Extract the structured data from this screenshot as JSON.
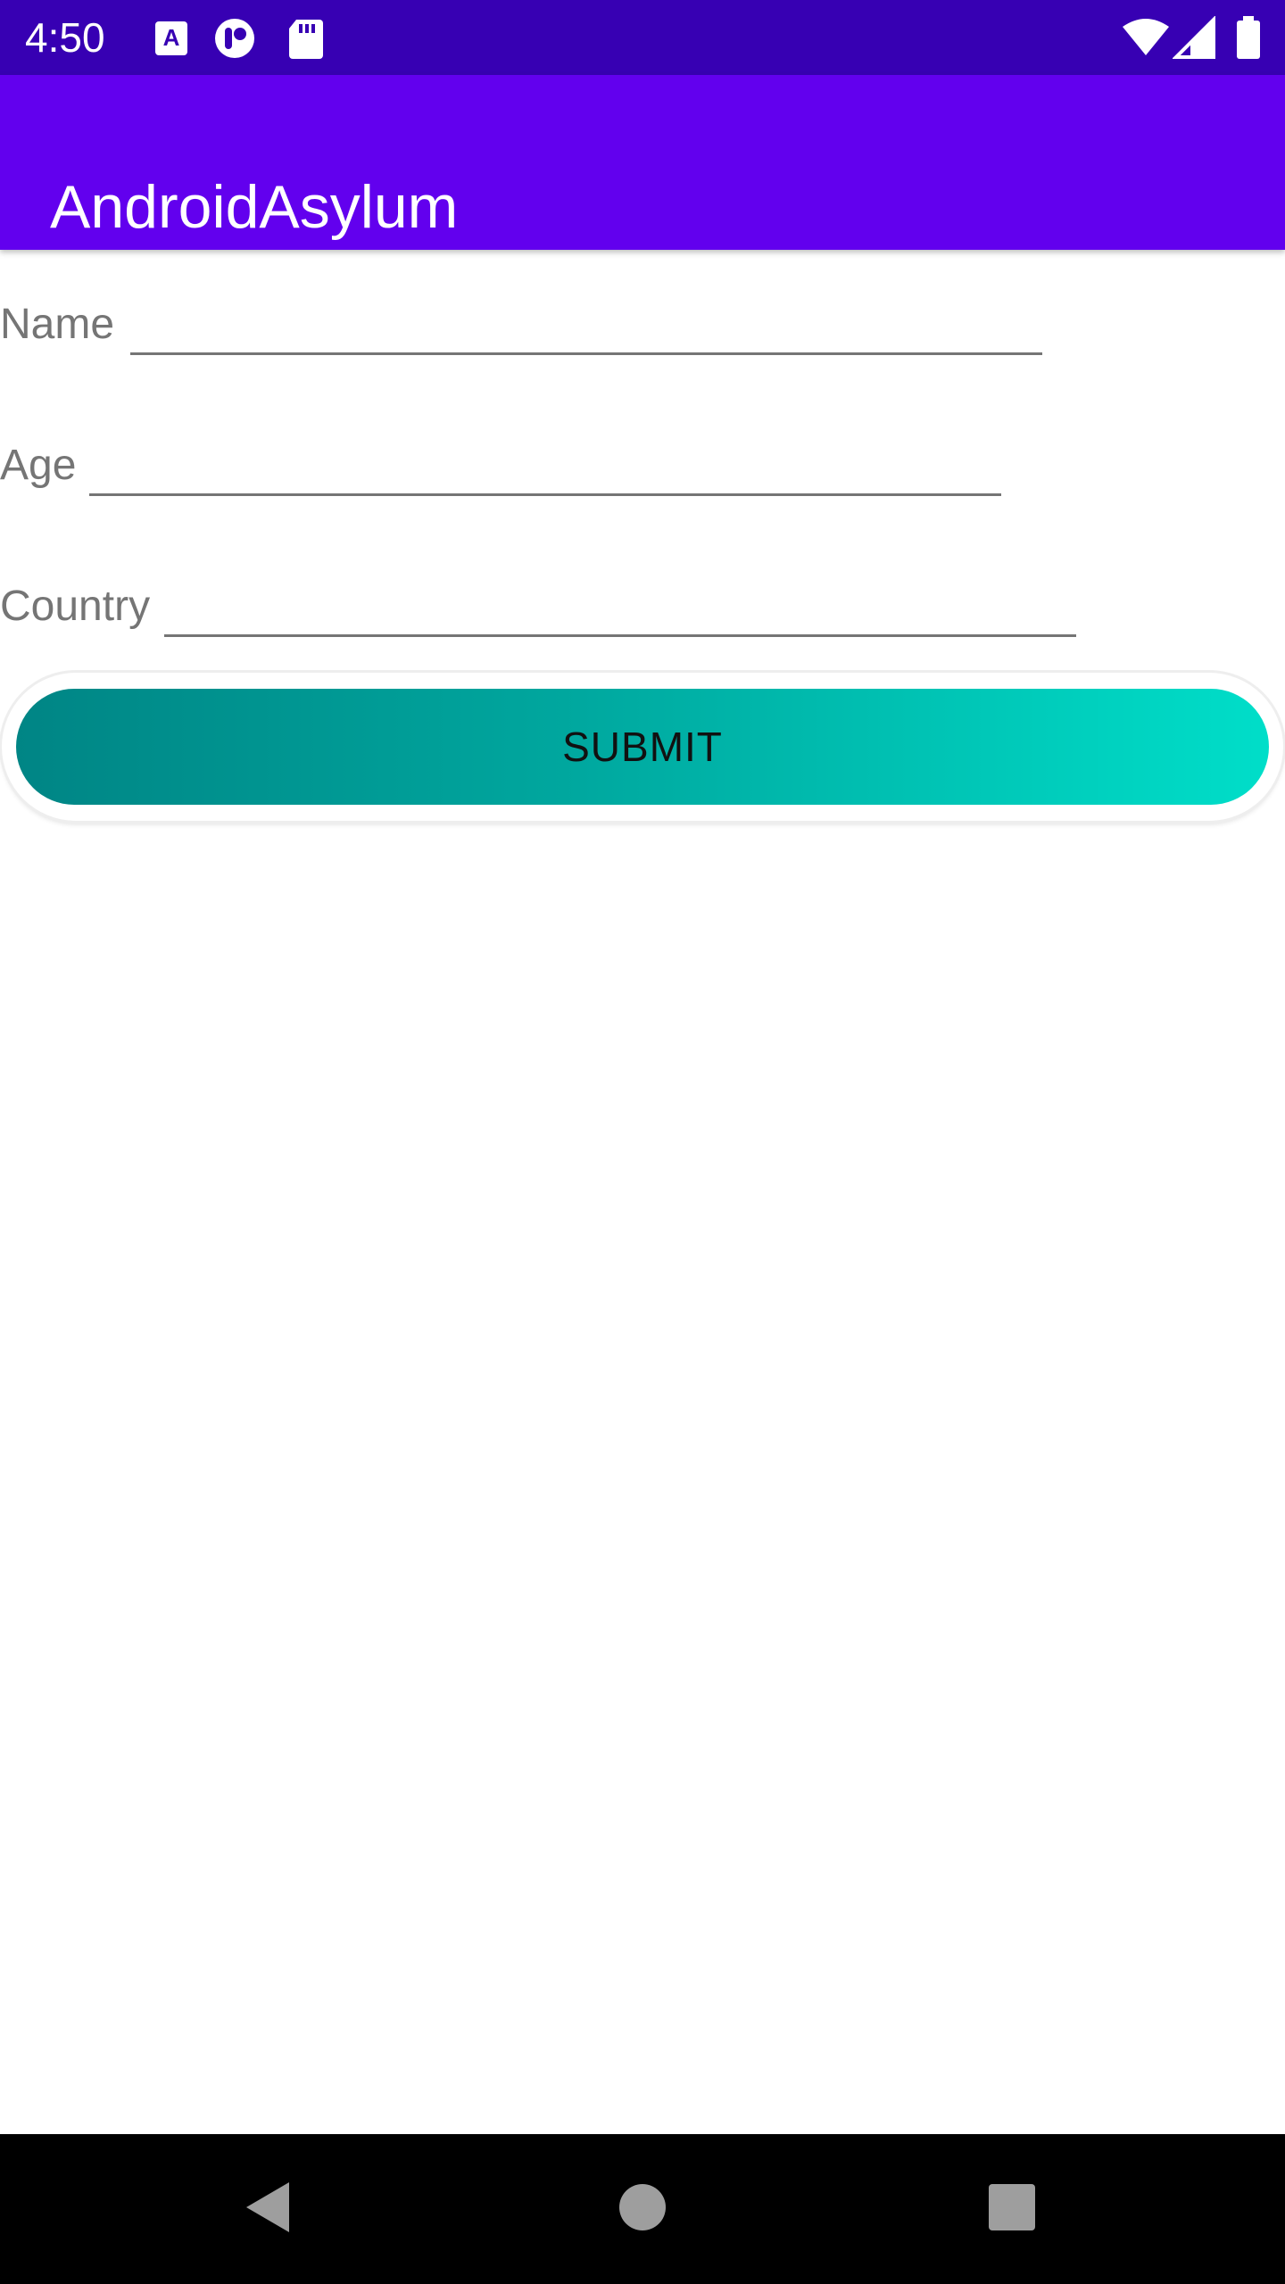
{
  "status_bar": {
    "time": "4:50",
    "notification_icons": [
      "keyboard-a-icon",
      "toggle-icon",
      "sd-card-icon"
    ],
    "system_icons": [
      "wifi-icon",
      "signal-icon",
      "battery-icon"
    ]
  },
  "app_bar": {
    "title": "AndroidAsylum",
    "color": "#6200ee",
    "status_color": "#3700b3"
  },
  "form": {
    "fields": [
      {
        "label": "Name",
        "value": "",
        "placeholder": ""
      },
      {
        "label": "Age",
        "value": "",
        "placeholder": ""
      },
      {
        "label": "Country",
        "value": "",
        "placeholder": ""
      }
    ],
    "submit_label": "SUBMIT",
    "submit_gradient": [
      "#008585",
      "#00dec9"
    ]
  },
  "nav_bar": {
    "buttons": [
      "back-icon",
      "home-icon",
      "recents-icon"
    ]
  }
}
